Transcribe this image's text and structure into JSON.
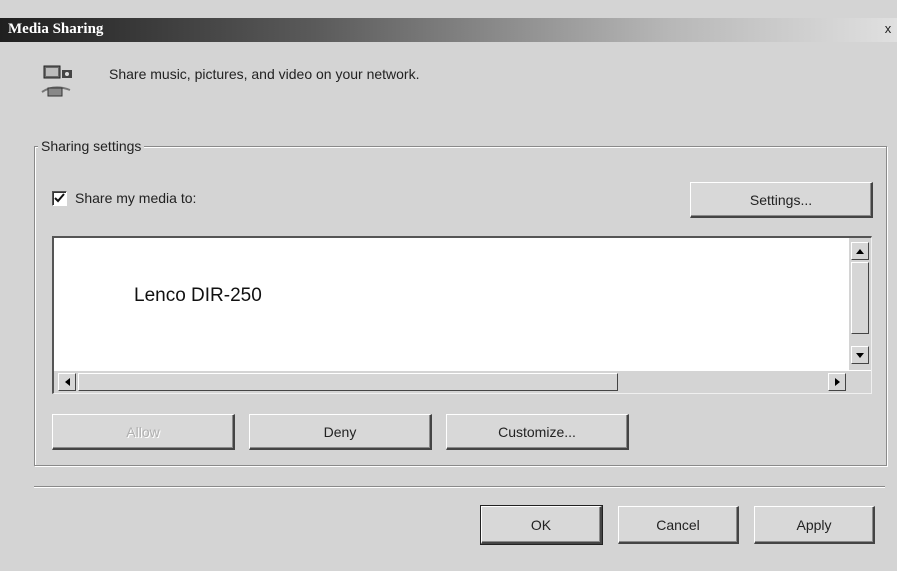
{
  "window": {
    "title": "Media Sharing",
    "close_glyph": "x"
  },
  "header": {
    "icon": "media-sharing-icon",
    "description": "Share music, pictures, and video on your network."
  },
  "sharing": {
    "group_label": "Sharing settings",
    "share_checkbox": {
      "label": "Share my media to:",
      "checked": true
    },
    "settings_button": "Settings...",
    "devices": [
      "Lenco DIR-250"
    ],
    "allow_button": "Allow",
    "deny_button": "Deny",
    "customize_button": "Customize..."
  },
  "footer": {
    "ok_button": "OK",
    "cancel_button": "Cancel",
    "apply_button": "Apply"
  }
}
